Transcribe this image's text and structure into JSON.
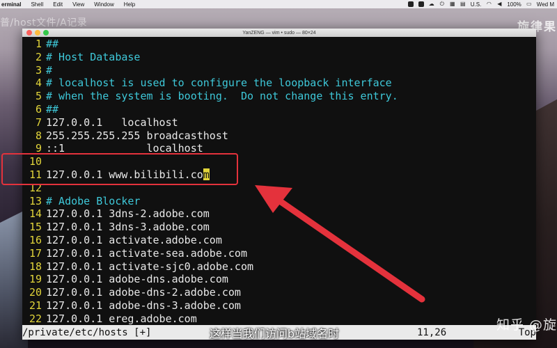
{
  "menubar": {
    "app": "erminal",
    "items": [
      "Shell",
      "Edit",
      "View",
      "Window",
      "Help"
    ],
    "locale": "U.S.",
    "battery": "100%",
    "clock": "Wed M"
  },
  "overlay": {
    "top_left": "普/host文件/A记录",
    "top_right": "旋律果"
  },
  "window": {
    "title": "YanZENG — vim • sudo — 80×24"
  },
  "editor": {
    "lines": [
      {
        "n": "1",
        "t": "##",
        "kind": "comment"
      },
      {
        "n": "2",
        "t": "# Host Database",
        "kind": "comment"
      },
      {
        "n": "3",
        "t": "#",
        "kind": "comment"
      },
      {
        "n": "4",
        "t": "# localhost is used to configure the loopback interface",
        "kind": "comment"
      },
      {
        "n": "5",
        "t": "# when the system is booting.  Do not change this entry.",
        "kind": "comment"
      },
      {
        "n": "6",
        "t": "##",
        "kind": "comment"
      },
      {
        "n": "7",
        "t": "127.0.0.1   localhost",
        "kind": "text"
      },
      {
        "n": "8",
        "t": "255.255.255.255 broadcasthost",
        "kind": "text"
      },
      {
        "n": "9",
        "t": "::1             localhost",
        "kind": "text"
      },
      {
        "n": "10",
        "t": "",
        "kind": "text"
      },
      {
        "n": "11",
        "t": "127.0.0.1 www.bilibili.co",
        "kind": "text",
        "cursor": "m"
      },
      {
        "n": "12",
        "t": "",
        "kind": "text"
      },
      {
        "n": "13",
        "t": "# Adobe Blocker",
        "kind": "comment"
      },
      {
        "n": "14",
        "t": "127.0.0.1 3dns-2.adobe.com",
        "kind": "text"
      },
      {
        "n": "15",
        "t": "127.0.0.1 3dns-3.adobe.com",
        "kind": "text"
      },
      {
        "n": "16",
        "t": "127.0.0.1 activate.adobe.com",
        "kind": "text"
      },
      {
        "n": "17",
        "t": "127.0.0.1 activate-sea.adobe.com",
        "kind": "text"
      },
      {
        "n": "18",
        "t": "127.0.0.1 activate-sjc0.adobe.com",
        "kind": "text"
      },
      {
        "n": "19",
        "t": "127.0.0.1 adobe-dns.adobe.com",
        "kind": "text"
      },
      {
        "n": "20",
        "t": "127.0.0.1 adobe-dns-2.adobe.com",
        "kind": "text"
      },
      {
        "n": "21",
        "t": "127.0.0.1 adobe-dns-3.adobe.com",
        "kind": "text"
      },
      {
        "n": "22",
        "t": "127.0.0.1 ereg.adobe.com",
        "kind": "text"
      }
    ]
  },
  "statusline": {
    "file": "/private/etc/hosts [+]",
    "position": "11,26",
    "scroll": "Top"
  },
  "subtitle": "这样当我们访问b站域名时",
  "watermark": "知乎 @旋",
  "colors": {
    "annotation": "#e4323c",
    "line_number": "#e1d43a",
    "comment": "#3ec8d9"
  }
}
